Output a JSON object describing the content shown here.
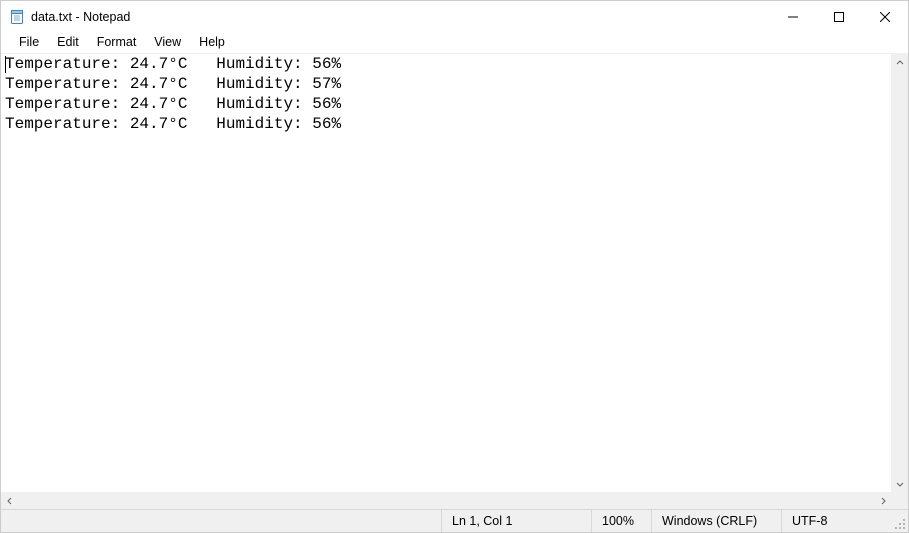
{
  "title": "data.txt - Notepad",
  "menu": {
    "file": "File",
    "edit": "Edit",
    "format": "Format",
    "view": "View",
    "help": "Help"
  },
  "content": "Temperature: 24.7°C   Humidity: 56%\nTemperature: 24.7°C   Humidity: 57%\nTemperature: 24.7°C   Humidity: 56%\nTemperature: 24.7°C   Humidity: 56%",
  "status": {
    "position": "Ln 1, Col 1",
    "zoom": "100%",
    "line_ending": "Windows (CRLF)",
    "encoding": "UTF-8"
  }
}
